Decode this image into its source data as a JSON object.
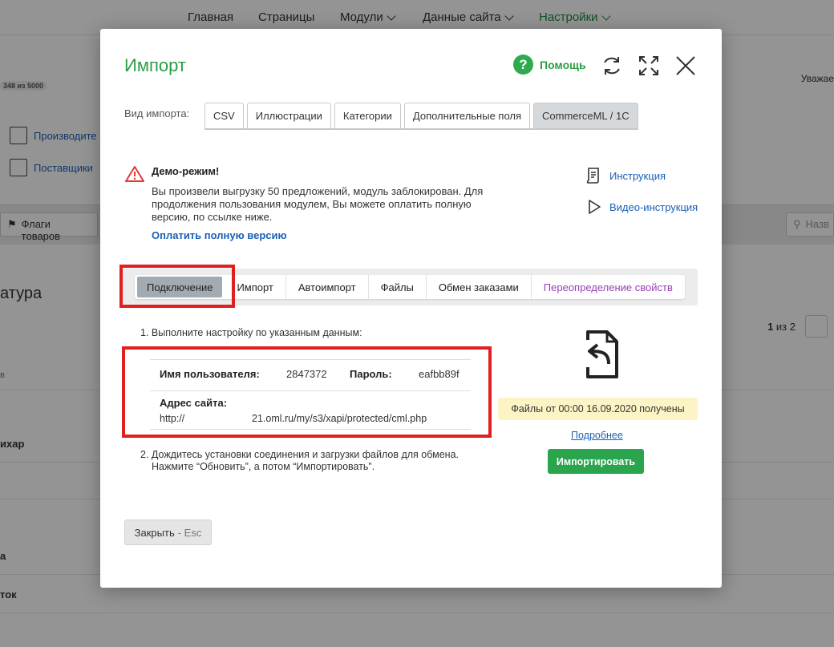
{
  "topnav": {
    "items": [
      {
        "label": "Главная"
      },
      {
        "label": "Страницы"
      },
      {
        "label": "Модули"
      },
      {
        "label": "Данные сайта"
      },
      {
        "label": "Настройки"
      }
    ]
  },
  "background": {
    "badge": "348 из 5000",
    "side_links": [
      "Производите",
      "Поставщики"
    ],
    "greeting": "Уважае",
    "flags_button": "Флаги товаров",
    "search_placeholder": "Назв",
    "page_title": "атура",
    "pager": {
      "current": "1",
      "of_text": "из 2"
    },
    "col_fragment": "в",
    "rows": [
      "ихар",
      "а",
      "ток"
    ]
  },
  "modal": {
    "title": "Импорт",
    "help_label": "Помощь",
    "import_type_label": "Вид импорта:",
    "import_types": [
      {
        "label": "CSV"
      },
      {
        "label": "Иллюстрации"
      },
      {
        "label": "Категории"
      },
      {
        "label": "Дополнительные поля"
      },
      {
        "label": "CommerceML / 1C"
      }
    ],
    "demo": {
      "title": "Демо-режим!",
      "text": "Вы произвели выгрузку 50 предложений, модуль заблокирован. Для продолжения пользования модулем, Вы можете оплатить полную версию, по ссылке ниже.",
      "link": "Оплатить полную версию"
    },
    "side_links": {
      "instruction": "Инструкция",
      "video": "Видео-инструкция"
    },
    "sub_tabs": [
      {
        "label": "Подключение"
      },
      {
        "label": "Импорт"
      },
      {
        "label": "Автоимпорт"
      },
      {
        "label": "Файлы"
      },
      {
        "label": "Обмен заказами"
      },
      {
        "label": "Переопределение свойств"
      }
    ],
    "step1": "1. Выполните настройку по указанным данным:",
    "credentials": {
      "username_label": "Имя пользователя:",
      "username": "2847372",
      "password_label": "Пароль:",
      "password": "eafbb89f",
      "address_label": "Адрес сайта:",
      "protocol": "http://",
      "url": "21.oml.ru/my/s3/xapi/protected/cml.php"
    },
    "step2_line1": "2. Дождитесь установки соединения и загрузки файлов для обмена.",
    "step2_line2": "Нажмите “Обновить”, а потом “Импортировать”.",
    "status": "Файлы от 00:00 16.09.2020 получены",
    "more_link": "Подробнее",
    "import_button": "Импортировать",
    "close_button": "Закрыть",
    "close_hint": "- Esc"
  },
  "colors": {
    "accent_green": "#2aa54d",
    "link_blue": "#1a5fb4",
    "highlight_red": "#e02020",
    "status_yellow": "#fcf4c4"
  }
}
